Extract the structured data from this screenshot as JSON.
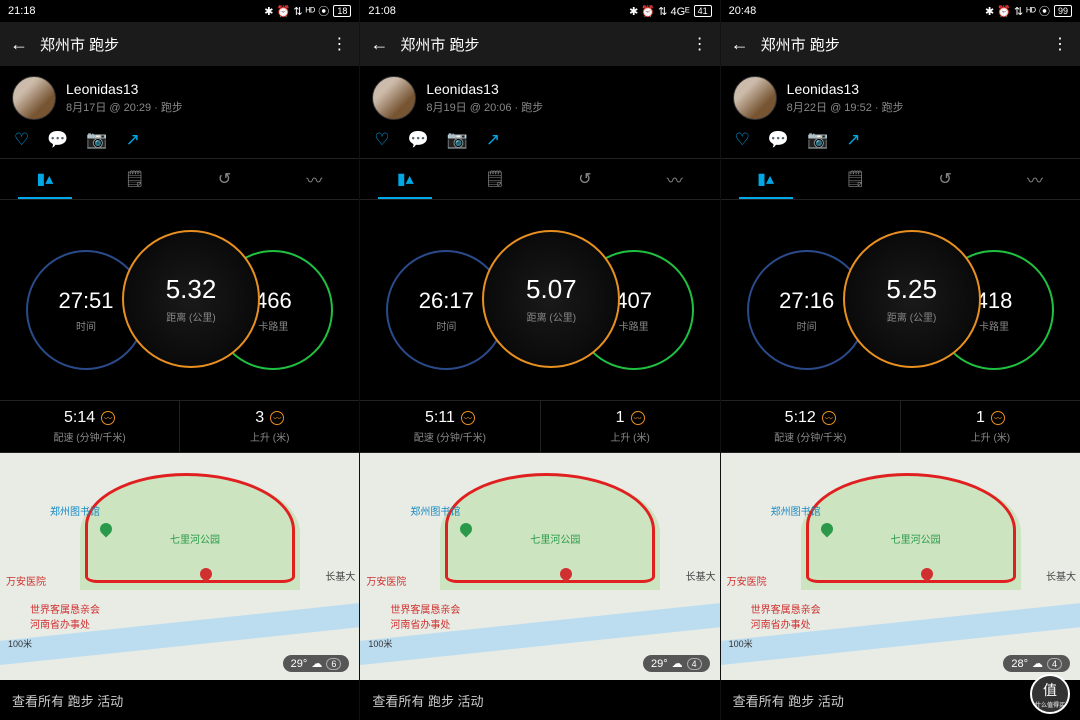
{
  "watermark": "什么值得买",
  "screens": [
    {
      "status": {
        "time": "21:18",
        "net": "...ⁱ",
        "icons": "✱ ⏰ ⇅ ᴴᴰ ⦿",
        "bat": "18"
      },
      "header": {
        "title": "郑州市 跑步"
      },
      "user": {
        "name": "Leonidas13",
        "meta": "8月17日 @ 20:29 · 跑步"
      },
      "rings": {
        "time": {
          "val": "27:51",
          "lab": "时间"
        },
        "dist": {
          "val": "5.32",
          "lab": "距离 (公里)"
        },
        "cal": {
          "val": "466",
          "lab": "卡路里"
        }
      },
      "metrics": {
        "pace": {
          "val": "5:14",
          "lab": "配速 (分钟/千米)"
        },
        "elev": {
          "val": "3",
          "lab": "上升 (米)"
        }
      },
      "map": {
        "lib": "郑州图书馆",
        "park": "七里河公园",
        "poi1": "万安医院",
        "poi2": "世界客属恳亲会\n河南省办事处",
        "poi3": "长基大",
        "scale": "100米",
        "weather": "29°",
        "wcount": "6"
      },
      "footer": "查看所有 跑步 活动"
    },
    {
      "status": {
        "time": "21:08",
        "net": "...ⁱ",
        "icons": "✱ ⏰ ⇅ 4Gᴱ ",
        "bat": "41"
      },
      "header": {
        "title": "郑州市 跑步"
      },
      "user": {
        "name": "Leonidas13",
        "meta": "8月19日 @ 20:06 · 跑步"
      },
      "rings": {
        "time": {
          "val": "26:17",
          "lab": "时间"
        },
        "dist": {
          "val": "5.07",
          "lab": "距离 (公里)"
        },
        "cal": {
          "val": "407",
          "lab": "卡路里"
        }
      },
      "metrics": {
        "pace": {
          "val": "5:11",
          "lab": "配速 (分钟/千米)"
        },
        "elev": {
          "val": "1",
          "lab": "上升 (米)"
        }
      },
      "map": {
        "lib": "郑州图书馆",
        "park": "七里河公园",
        "poi1": "万安医院",
        "poi2": "世界客属恳亲会\n河南省办事处",
        "poi3": "长基大",
        "scale": "100米",
        "weather": "29°",
        "wcount": "4"
      },
      "footer": "查看所有 跑步 活动"
    },
    {
      "status": {
        "time": "20:48",
        "net": "...ⁱ",
        "icons": "✱ ⏰ ⇅ ᴴᴰ ⦿",
        "bat": "99"
      },
      "header": {
        "title": "郑州市 跑步"
      },
      "user": {
        "name": "Leonidas13",
        "meta": "8月22日 @ 19:52 · 跑步"
      },
      "rings": {
        "time": {
          "val": "27:16",
          "lab": "时间"
        },
        "dist": {
          "val": "5.25",
          "lab": "距离 (公里)"
        },
        "cal": {
          "val": "418",
          "lab": "卡路里"
        }
      },
      "metrics": {
        "pace": {
          "val": "5:12",
          "lab": "配速 (分钟/千米)"
        },
        "elev": {
          "val": "1",
          "lab": "上升 (米)"
        }
      },
      "map": {
        "lib": "郑州图书馆",
        "park": "七里河公园",
        "poi1": "万安医院",
        "poi2": "世界客属恳亲会\n河南省办事处",
        "poi3": "长基大",
        "scale": "100米",
        "weather": "28°",
        "wcount": "4"
      },
      "footer": "查看所有 跑步 活动"
    }
  ]
}
